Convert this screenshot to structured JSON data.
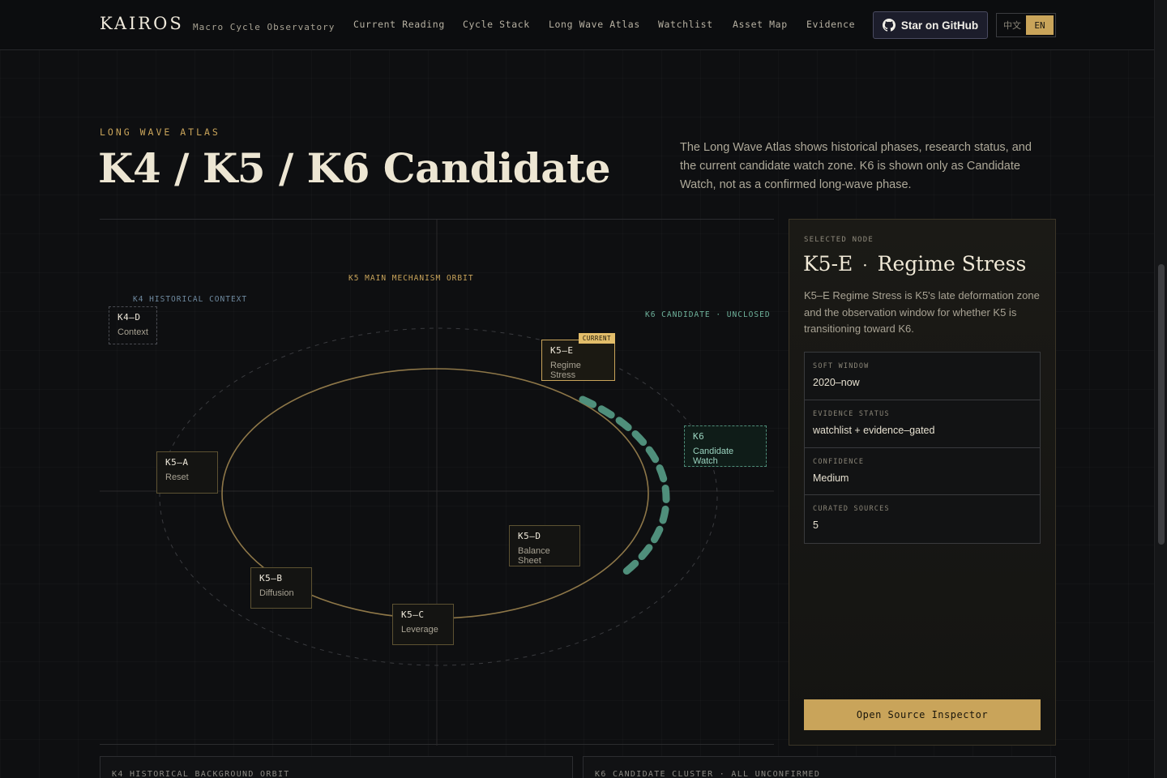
{
  "header": {
    "brand": "KAIROS",
    "brand_sub": "Macro Cycle Observatory",
    "nav": [
      "Current Reading",
      "Cycle Stack",
      "Long Wave Atlas",
      "Watchlist",
      "Asset Map",
      "Evidence"
    ],
    "github_label": "Star on GitHub",
    "lang": [
      "中文",
      "EN"
    ],
    "lang_active": "EN"
  },
  "hero": {
    "eyebrow": "LONG WAVE ATLAS",
    "title": "K4 / K5 / K6 Candidate",
    "intro": "The Long Wave Atlas shows historical phases, research status, and the current candidate watch zone. K6 is shown only as Candidate Watch, not as a confirmed long-wave phase."
  },
  "atlas": {
    "labels": {
      "k5_orbit": "K5 MAIN MECHANISM ORBIT",
      "k4_context": "K4 HISTORICAL CONTEXT",
      "k6_candidate": "K6 CANDIDATE · UNCLOSED"
    },
    "nodes": {
      "k4d": {
        "code": "K4–D",
        "name": "Context"
      },
      "k5a": {
        "code": "K5–A",
        "name": "Reset"
      },
      "k5b": {
        "code": "K5–B",
        "name": "Diffusion"
      },
      "k5c": {
        "code": "K5–C",
        "name": "Leverage"
      },
      "k5d": {
        "code": "K5–D",
        "name": "Balance Sheet"
      },
      "k5e": {
        "code": "K5–E",
        "name": "Regime Stress",
        "badge": "CURRENT"
      },
      "k6": {
        "code": "K6",
        "name": "Candidate Watch"
      }
    },
    "colors": {
      "gold": "#c9a45a",
      "teal": "#4f8f7b"
    }
  },
  "inspector": {
    "eyebrow": "SELECTED NODE",
    "title_code": "K5-E",
    "title_sep": "·",
    "title_name": "Regime Stress",
    "description": "K5–E Regime Stress is K5's late deformation zone and the observation window for whether K5 is transitioning toward K6.",
    "facts": [
      {
        "key": "SOFT WINDOW",
        "value": "2020–now"
      },
      {
        "key": "EVIDENCE STATUS",
        "value": "watchlist + evidence–gated"
      },
      {
        "key": "CONFIDENCE",
        "value": "Medium"
      },
      {
        "key": "CURATED SOURCES",
        "value": "5"
      }
    ],
    "button": "Open Source Inspector"
  },
  "bottom_cards": [
    "K4 HISTORICAL BACKGROUND ORBIT",
    "K6 CANDIDATE CLUSTER · ALL UNCONFIRMED"
  ]
}
